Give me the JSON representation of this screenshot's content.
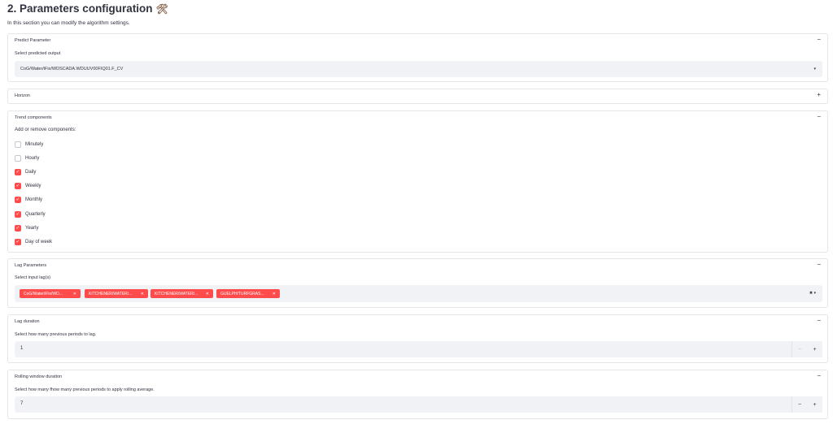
{
  "header": {
    "title": "2. Parameters configuration",
    "title_icon": "🛠",
    "subtitle": "In this section you can modify the algorithm settings."
  },
  "predict": {
    "title": "Predict Parameter",
    "toggle": "−",
    "label": "Select predicted output",
    "value": "CoG/Water/iFix/WDSCADA.WDUUV00FIQ01.F_CV"
  },
  "horizon": {
    "title": "Horizon",
    "toggle": "+"
  },
  "trend": {
    "title": "Trend components",
    "toggle": "−",
    "label": "Add or remove components:",
    "items": [
      {
        "label": "Minutely",
        "checked": false
      },
      {
        "label": "Hourly",
        "checked": false
      },
      {
        "label": "Daily",
        "checked": true
      },
      {
        "label": "Weekly",
        "checked": true
      },
      {
        "label": "Monthly",
        "checked": true
      },
      {
        "label": "Quarterly",
        "checked": true
      },
      {
        "label": "Yearly",
        "checked": true
      },
      {
        "label": "Day of week",
        "checked": true
      }
    ]
  },
  "lag": {
    "title": "Lag Parameters",
    "toggle": "−",
    "label": "Select input lag(s)",
    "tags": [
      "CoG/Water/iFix/WD...",
      "KITCHENER/WATER/...",
      "KITCHENER/WATER/...",
      "GUELPH/TURFGRAS..."
    ]
  },
  "lag_duration": {
    "title": "Lag duration",
    "toggle": "−",
    "label": "Select how many previous periods to lag.",
    "value": "1",
    "minus": "−",
    "plus": "+"
  },
  "rolling": {
    "title": "Rolling window duration",
    "toggle": "−",
    "label": "Select how many fhow many previous periods to apply rolling average.",
    "value": "7",
    "minus": "−",
    "plus": "+"
  },
  "colors": {
    "accent": "#ff4b4b",
    "input_bg": "#f0f2f6",
    "border": "#e6e6ea"
  }
}
